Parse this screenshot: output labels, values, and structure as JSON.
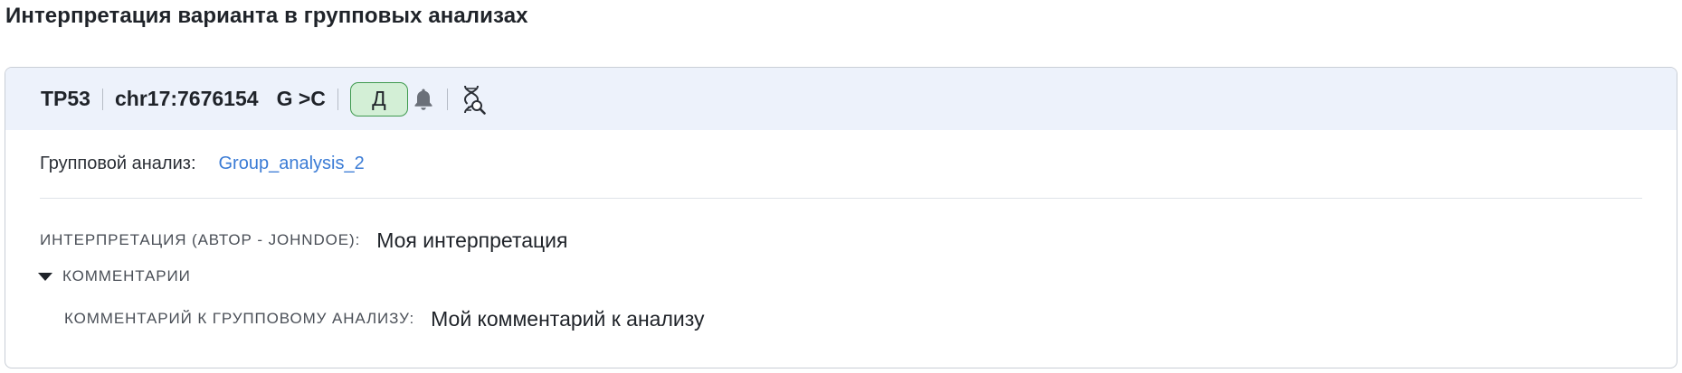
{
  "section": {
    "title": "Интерпретация варианта в групповых анализах"
  },
  "variant": {
    "gene": "TP53",
    "position": "chr17:7676154",
    "change": "G >C",
    "badge": "Д",
    "badge_bg": "#d3efd6",
    "badge_border": "#3f9a4f",
    "icons": [
      "bell-icon",
      "dna-search-icon"
    ]
  },
  "group": {
    "label": "Групповой анализ:",
    "link": "Group_analysis_2",
    "link_color": "#3a7bd5"
  },
  "interpretation": {
    "label": "ИНТЕРПРЕТАЦИЯ (АВТОР - JOHNDOE):",
    "value": "Моя интерпретация"
  },
  "comments": {
    "toggle_label": "КОММЕНТАРИИ",
    "expanded": true,
    "items": [
      {
        "label": "КОММЕНТАРИЙ К ГРУППОВОМУ АНАЛИЗУ:",
        "value": "Мой комментарий к анализу"
      }
    ]
  },
  "colors": {
    "header_bg": "#edf2fb",
    "border": "#c9ced6"
  }
}
